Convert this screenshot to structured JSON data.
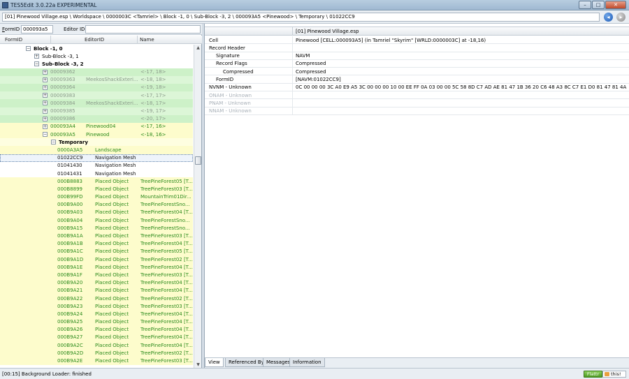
{
  "window": {
    "title": "TES5Edit 3.0.22a EXPERIMENTAL",
    "minimize": "–",
    "maximize": "□",
    "close": "✕"
  },
  "path": "[01] Pinewood Village.esp \\ Worldspace \\ 0000003C <Tamriel> \\ Block -1, 0 \\ Sub-Block -3, 2 \\ 000093A5 <Pinewood> \\ Temporary \\ 01022CC9",
  "icons": {
    "back": "back-arrow-icon",
    "forward": "forward-arrow-icon"
  },
  "filter": {
    "formid_label_u": "F",
    "formid_label_rest": "ormID",
    "formid_value": "000093a5",
    "editorid_label": "Editor ID",
    "editorid_value": ""
  },
  "tree": {
    "columns": [
      "FormID",
      "EditorID",
      "Name"
    ],
    "rows": [
      {
        "indent": 1,
        "exp": "-",
        "formid": "Block -1, 0",
        "editorid": "",
        "name": "",
        "style": "",
        "bold": true
      },
      {
        "indent": 2,
        "exp": "+",
        "formid": "Sub-Block -3, 1",
        "editorid": "",
        "name": "",
        "style": "",
        "bold": false
      },
      {
        "indent": 2,
        "exp": "-",
        "formid": "Sub-Block -3, 2",
        "editorid": "",
        "name": "",
        "style": "",
        "bold": true
      },
      {
        "indent": 3,
        "exp": "+",
        "formid": "00009362",
        "editorid": "",
        "name": "<-17, 18>",
        "style": "g1",
        "tone": "grey"
      },
      {
        "indent": 3,
        "exp": "+",
        "formid": "00009363",
        "editorid": "MeekosShackExteri...",
        "name": "<-18, 18>",
        "style": "g2",
        "tone": "grey"
      },
      {
        "indent": 3,
        "exp": "+",
        "formid": "00009364",
        "editorid": "",
        "name": "<-19, 18>",
        "style": "g1",
        "tone": "grey"
      },
      {
        "indent": 3,
        "exp": "+",
        "formid": "00009383",
        "editorid": "",
        "name": "<-17, 17>",
        "style": "g2",
        "tone": "grey"
      },
      {
        "indent": 3,
        "exp": "+",
        "formid": "00009384",
        "editorid": "MeekosShackExteri...",
        "name": "<-18, 17>",
        "style": "g1",
        "tone": "grey"
      },
      {
        "indent": 3,
        "exp": "+",
        "formid": "00009385",
        "editorid": "",
        "name": "<-19, 17>",
        "style": "g2",
        "tone": "grey"
      },
      {
        "indent": 3,
        "exp": "+",
        "formid": "00009386",
        "editorid": "",
        "name": "<-20, 17>",
        "style": "g1",
        "tone": "grey"
      },
      {
        "indent": 3,
        "exp": "+",
        "formid": "000093A4",
        "editorid": "Pinewood04",
        "name": "<-17, 16>",
        "style": "y1",
        "tone": "green"
      },
      {
        "indent": 3,
        "exp": "-",
        "formid": "000093A5",
        "editorid": "Pinewood",
        "name": "<-18, 16>",
        "style": "y1",
        "tone": "green"
      },
      {
        "indent": 4,
        "exp": "-",
        "formid": "Temporary",
        "editorid": "",
        "name": "",
        "style": "y2",
        "bold": true
      },
      {
        "indent": 5,
        "exp": "",
        "formid": "0000A3A5",
        "editorid": "Landscape",
        "name": "",
        "style": "y1",
        "tone": "green",
        "inline": true
      },
      {
        "indent": 5,
        "exp": "",
        "formid": "01022CC9",
        "editorid": "Navigation Mesh",
        "name": "",
        "style": "sel",
        "tone": "dark",
        "inline": true
      },
      {
        "indent": 5,
        "exp": "",
        "formid": "01041430",
        "editorid": "Navigation Mesh",
        "name": "",
        "style": "",
        "tone": "dark",
        "inline": true
      },
      {
        "indent": 5,
        "exp": "",
        "formid": "01041431",
        "editorid": "Navigation Mesh",
        "name": "",
        "style": "",
        "tone": "dark",
        "inline": true
      },
      {
        "indent": 5,
        "exp": "",
        "formid": "000B8883",
        "editorid": "Placed Object",
        "name": "TreePineForest05 [T...",
        "style": "y1",
        "tone": "green",
        "inline": true
      },
      {
        "indent": 5,
        "exp": "",
        "formid": "000B8899",
        "editorid": "Placed Object",
        "name": "TreePineForest03 [T...",
        "style": "y1",
        "tone": "green",
        "inline": true
      },
      {
        "indent": 5,
        "exp": "",
        "formid": "000B99FD",
        "editorid": "Placed Object",
        "name": "MountainTrim01Dir...",
        "style": "y1",
        "tone": "green",
        "inline": true
      },
      {
        "indent": 5,
        "exp": "",
        "formid": "000B9A00",
        "editorid": "Placed Object",
        "name": "TreePineForestSno...",
        "style": "y1",
        "tone": "green",
        "inline": true
      },
      {
        "indent": 5,
        "exp": "",
        "formid": "000B9A03",
        "editorid": "Placed Object",
        "name": "TreePineForest04 [T...",
        "style": "y1",
        "tone": "green",
        "inline": true
      },
      {
        "indent": 5,
        "exp": "",
        "formid": "000B9A04",
        "editorid": "Placed Object",
        "name": "TreePineForestSno...",
        "style": "y1",
        "tone": "green",
        "inline": true
      },
      {
        "indent": 5,
        "exp": "",
        "formid": "000B9A15",
        "editorid": "Placed Object",
        "name": "TreePineForestSno...",
        "style": "y1",
        "tone": "green",
        "inline": true
      },
      {
        "indent": 5,
        "exp": "",
        "formid": "000B9A1A",
        "editorid": "Placed Object",
        "name": "TreePineForest03 [T...",
        "style": "y1",
        "tone": "green",
        "inline": true
      },
      {
        "indent": 5,
        "exp": "",
        "formid": "000B9A1B",
        "editorid": "Placed Object",
        "name": "TreePineForest04 [T...",
        "style": "y1",
        "tone": "green",
        "inline": true
      },
      {
        "indent": 5,
        "exp": "",
        "formid": "000B9A1C",
        "editorid": "Placed Object",
        "name": "TreePineForest05 [T...",
        "style": "y1",
        "tone": "green",
        "inline": true
      },
      {
        "indent": 5,
        "exp": "",
        "formid": "000B9A1D",
        "editorid": "Placed Object",
        "name": "TreePineForest02 [T...",
        "style": "y1",
        "tone": "green",
        "inline": true
      },
      {
        "indent": 5,
        "exp": "",
        "formid": "000B9A1E",
        "editorid": "Placed Object",
        "name": "TreePineForest04 [T...",
        "style": "y1",
        "tone": "green",
        "inline": true
      },
      {
        "indent": 5,
        "exp": "",
        "formid": "000B9A1F",
        "editorid": "Placed Object",
        "name": "TreePineForest03 [T...",
        "style": "y1",
        "tone": "green",
        "inline": true
      },
      {
        "indent": 5,
        "exp": "",
        "formid": "000B9A20",
        "editorid": "Placed Object",
        "name": "TreePineForest04 [T...",
        "style": "y1",
        "tone": "green",
        "inline": true
      },
      {
        "indent": 5,
        "exp": "",
        "formid": "000B9A21",
        "editorid": "Placed Object",
        "name": "TreePineForest04 [T...",
        "style": "y1",
        "tone": "green",
        "inline": true
      },
      {
        "indent": 5,
        "exp": "",
        "formid": "000B9A22",
        "editorid": "Placed Object",
        "name": "TreePineForest02 [T...",
        "style": "y1",
        "tone": "green",
        "inline": true
      },
      {
        "indent": 5,
        "exp": "",
        "formid": "000B9A23",
        "editorid": "Placed Object",
        "name": "TreePineForest03 [T...",
        "style": "y1",
        "tone": "green",
        "inline": true
      },
      {
        "indent": 5,
        "exp": "",
        "formid": "000B9A24",
        "editorid": "Placed Object",
        "name": "TreePineForest04 [T...",
        "style": "y1",
        "tone": "green",
        "inline": true
      },
      {
        "indent": 5,
        "exp": "",
        "formid": "000B9A25",
        "editorid": "Placed Object",
        "name": "TreePineForest04 [T...",
        "style": "y1",
        "tone": "green",
        "inline": true
      },
      {
        "indent": 5,
        "exp": "",
        "formid": "000B9A26",
        "editorid": "Placed Object",
        "name": "TreePineForest04 [T...",
        "style": "y1",
        "tone": "green",
        "inline": true
      },
      {
        "indent": 5,
        "exp": "",
        "formid": "000B9A27",
        "editorid": "Placed Object",
        "name": "TreePineForest04 [T...",
        "style": "y1",
        "tone": "green",
        "inline": true
      },
      {
        "indent": 5,
        "exp": "",
        "formid": "000B9A2C",
        "editorid": "Placed Object",
        "name": "TreePineForest04 [T...",
        "style": "y1",
        "tone": "green",
        "inline": true
      },
      {
        "indent": 5,
        "exp": "",
        "formid": "000B9A2D",
        "editorid": "Placed Object",
        "name": "TreePineForest02 [T...",
        "style": "y1",
        "tone": "green",
        "inline": true
      },
      {
        "indent": 5,
        "exp": "",
        "formid": "000B9A2E",
        "editorid": "Placed Object",
        "name": "TreePineForest03 [T...",
        "style": "y1",
        "tone": "green",
        "inline": true
      }
    ]
  },
  "record": {
    "column_header": "[01] Pinewood Village.esp",
    "rows": [
      {
        "indent": 0,
        "key": "Cell",
        "value": "Pinewood [CELL:000093A5] (in Tamriel \"Skyrim\" [WRLD:0000003C] at -18,16)",
        "unknown": false
      },
      {
        "indent": 0,
        "key": "Record Header",
        "value": "",
        "unknown": false
      },
      {
        "indent": 1,
        "key": "Signature",
        "value": "NAVM",
        "unknown": false
      },
      {
        "indent": 1,
        "key": "Record Flags",
        "value": "Compressed",
        "unknown": false
      },
      {
        "indent": 2,
        "key": "Compressed",
        "value": "Compressed",
        "unknown": false
      },
      {
        "indent": 1,
        "key": "FormID",
        "value": "[NAVM:01022CC9]",
        "unknown": false
      },
      {
        "indent": 0,
        "key": "NVNM - Unknown",
        "value": "0C 00 00 00 3C A0 E9 A5 3C 00 00 00 10 00 EE FF 0A 03 00 00 5C 58 8D C7 AD AE 81 47 1B 36 20 C6 48 A3 8C C7 E1 D0 81 47 81 4A 20 C6 08 F9 8...",
        "unknown": false
      },
      {
        "indent": 0,
        "key": "ONAM - Unknown",
        "value": "",
        "unknown": true
      },
      {
        "indent": 0,
        "key": "PNAM - Unknown",
        "value": "",
        "unknown": true
      },
      {
        "indent": 0,
        "key": "NNAM - Unknown",
        "value": "",
        "unknown": true
      }
    ],
    "tabs": [
      "View",
      "Referenced By",
      "Messages",
      "Information"
    ],
    "active_tab": "View"
  },
  "status": {
    "text": "[00:15] Background Loader: finished",
    "flattr": "Flattr",
    "this": "this!"
  }
}
